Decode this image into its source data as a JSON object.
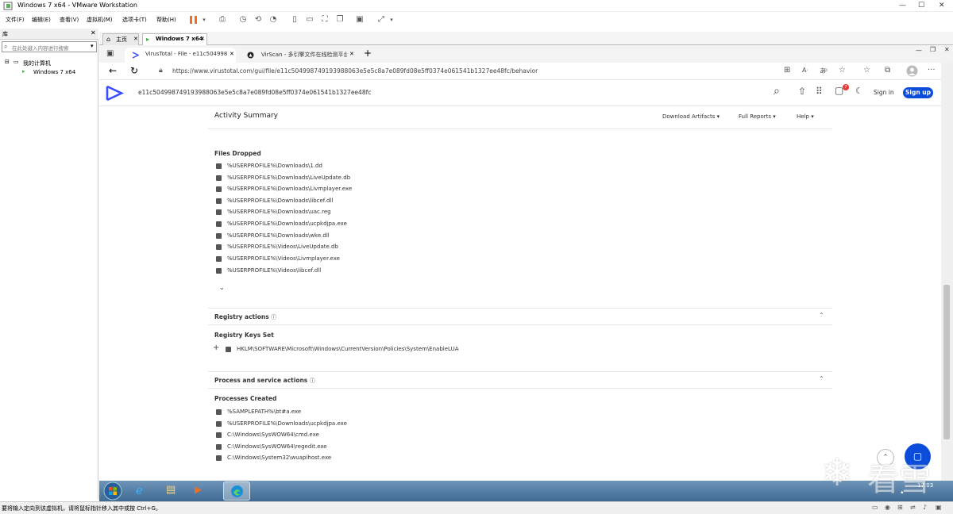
{
  "vmware": {
    "title": "Windows 7 x64 - VMware Workstation",
    "menus": [
      "文件(F)",
      "编辑(E)",
      "查看(V)",
      "虚拟机(M)",
      "选项卡(T)",
      "帮助(H)"
    ],
    "library_title": "库",
    "library_search_placeholder": "在此处键入内容进行搜索",
    "tree_root": "我的计算机",
    "tree_vm": "Windows 7 x64",
    "tabs": [
      "主页",
      "Windows 7 x64"
    ],
    "status_text": "要将输入定向到该虚拟机，请将鼠标指针移入其中或按 Ctrl+G。"
  },
  "browser": {
    "tabs": [
      "VirusTotal - File - e11c504998749...",
      "VirScan - 多引擎文件在线检测平台"
    ],
    "url": "https://www.virustotal.com/gui/file/e11c504998749193988063e5e5c8a7e089fd08e5ff0374e061541b1327ee48fc/behavior"
  },
  "vt": {
    "hash": "e11c504998749193988063e5e5c8a7e089fd08e5ff0374e061541b1327ee48fc",
    "sign_in": "Sign in",
    "sign_up": "Sign up",
    "notif_count": "7",
    "activity_summary": "Activity Summary",
    "download_artifacts": "Download Artifacts",
    "full_reports": "Full Reports",
    "help": "Help",
    "files_dropped_title": "Files Dropped",
    "files_dropped": [
      "%USERPROFILE%\\Downloads\\1.dd",
      "%USERPROFILE%\\Downloads\\LiveUpdate.db",
      "%USERPROFILE%\\Downloads\\Livmplayer.exe",
      "%USERPROFILE%\\Downloads\\libcef.dll",
      "%USERPROFILE%\\Downloads\\uac.reg",
      "%USERPROFILE%\\Downloads\\ucpkdjpa.exe",
      "%USERPROFILE%\\Downloads\\wke.dll",
      "%USERPROFILE%\\Videos\\LiveUpdate.db",
      "%USERPROFILE%\\Videos\\Livmplayer.exe",
      "%USERPROFILE%\\Videos\\libcef.dll"
    ],
    "registry_actions": "Registry actions",
    "registry_keys_set_title": "Registry Keys Set",
    "registry_key": "HKLM\\SOFTWARE\\Microsoft\\Windows\\CurrentVersion\\Policies\\System\\EnableLUA",
    "process_actions": "Process and service actions",
    "processes_created_title": "Processes Created",
    "processes": [
      "%SAMPLEPATH%\\bt#a.exe",
      "%USERPROFILE%\\Downloads\\ucpkdjpa.exe",
      "C:\\Windows\\SysWOW64\\cmd.exe",
      "C:\\Windows\\SysWOW64\\regedit.exe",
      "C:\\Windows\\System32\\wuapihost.exe"
    ]
  },
  "watermark": "看雪",
  "clock": "17:03",
  "colors": {
    "vt_blue": "#0b4dda",
    "brand_blue": "#394eff",
    "taskbar": "#4a76a0"
  }
}
